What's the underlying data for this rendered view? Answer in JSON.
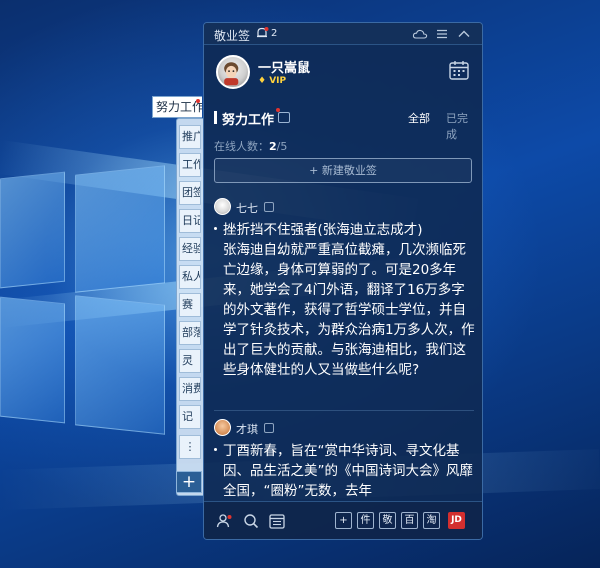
{
  "window": {
    "app_title": "敬业签",
    "notification_count": "2",
    "icons": [
      "bell-icon",
      "cloud-icon",
      "menu-icon",
      "collapse-icon"
    ]
  },
  "side_tabs": {
    "active_label": "努力工作",
    "items": [
      "推广",
      "工作",
      "团签",
      "日记",
      "经验",
      "私人",
      "赛",
      "部落",
      "灵",
      "消费",
      "记",
      "⋮"
    ],
    "add_label": "+"
  },
  "profile": {
    "username": "一只嵩鼠",
    "badge": "VIP"
  },
  "section": {
    "title": "努力工作",
    "filter_all": "全部",
    "filter_done": "已完成"
  },
  "online": {
    "label": "在线人数：",
    "current": "2",
    "total": "/5"
  },
  "new_note_button": "+ 新建敬业签",
  "posts": [
    {
      "author": "七七",
      "text": "挫折挡不住强者(张海迪立志成才)\n张海迪自幼就严重高位截瘫，几次濒临死亡边缘，身体可算弱的了。可是20多年来，她学会了4门外语，翻译了16万多字的外文著作，获得了哲学硕士学位，并自学了针灸技术，为群众治病1万多人次，作出了巨大的贡献。与张海迪相比，我们这些身体健壮的人又当做些什么呢?"
    },
    {
      "author": "才琪",
      "text": "丁酉新春，旨在“赏中华诗词、寻文化基因、品生活之美”的《中国诗词大会》风靡全国，“圈粉”无数，去年"
    }
  ],
  "bottom_bar": {
    "icons": [
      "team-icon",
      "search-icon",
      "calendar-list-icon"
    ],
    "shortcuts": [
      "+",
      "件",
      "敬",
      "百",
      "淘",
      "JD"
    ]
  }
}
